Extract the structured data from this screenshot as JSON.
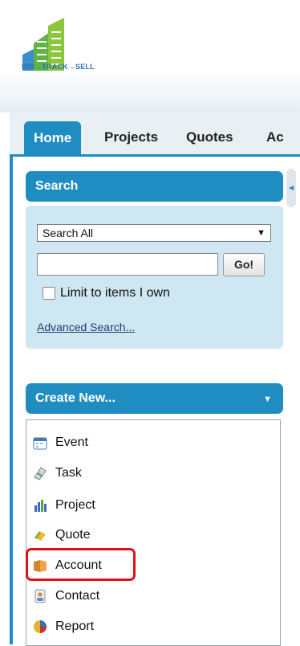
{
  "brand": {
    "logo_text": "BID→TRACK→SELL"
  },
  "tabs": [
    {
      "label": "Home",
      "active": true
    },
    {
      "label": "Projects",
      "active": false
    },
    {
      "label": "Quotes",
      "active": false
    },
    {
      "label": "Ac",
      "active": false
    }
  ],
  "search": {
    "title": "Search",
    "scope_selected": "Search All",
    "query_value": "",
    "go_label": "Go!",
    "limit_checked": false,
    "limit_label": "Limit to items I own",
    "advanced_link": "Advanced Search..."
  },
  "create_new": {
    "title": "Create New...",
    "items": [
      {
        "label": "Event",
        "icon": "calendar-icon"
      },
      {
        "label": "Task",
        "icon": "task-icon"
      },
      {
        "label": "Project",
        "icon": "project-chart-icon"
      },
      {
        "label": "Quote",
        "icon": "quote-icon"
      },
      {
        "label": "Account",
        "icon": "account-folder-icon",
        "highlighted": true
      },
      {
        "label": "Contact",
        "icon": "contact-icon"
      },
      {
        "label": "Report",
        "icon": "report-icon"
      }
    ]
  },
  "colors": {
    "accent": "#1f8dc2",
    "panel_bg": "#cfe7f2",
    "highlight": "#e0101b"
  }
}
